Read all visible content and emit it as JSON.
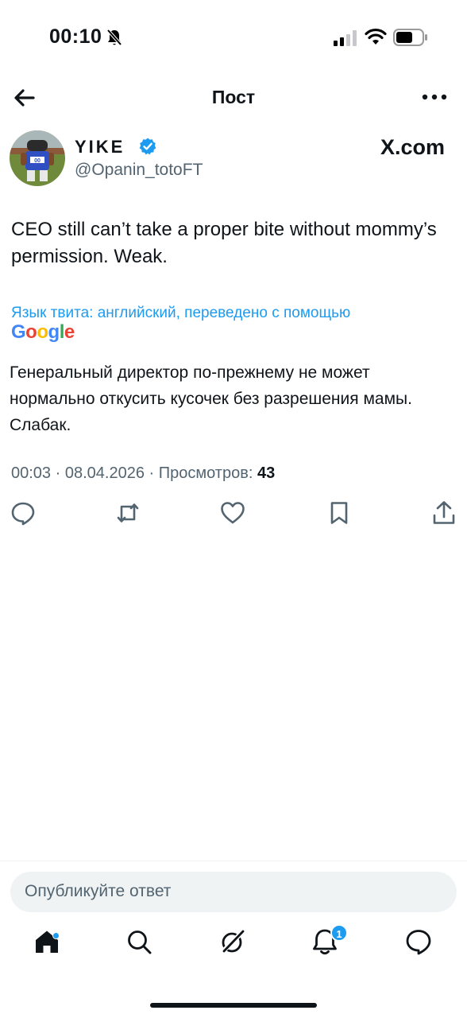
{
  "status_bar": {
    "time": "00:10",
    "icons": [
      "bell-off-icon",
      "signal-icon",
      "wifi-icon",
      "battery-icon"
    ]
  },
  "header": {
    "title": "Пост",
    "back_icon": "arrow-left-icon",
    "more_icon": "more-horizontal-icon"
  },
  "author": {
    "display_name": "YIKE",
    "handle": "@Opanin_totoFT",
    "verified": true,
    "source_logo": "X.com"
  },
  "tweet": {
    "text": "CEO still can’t take a proper bite without mommy’s permission. Weak.",
    "translation_note": "Язык твита: английский, переведено с помощью",
    "translation_provider": "Google",
    "translated_text": "Генеральный директор по-прежнему не может нормально откусить кусочек без разрешения мамы. Слабак.",
    "time": "00:03",
    "date": "08.04.2026",
    "views_label": "Просмотров:",
    "views_count": "43"
  },
  "actions": [
    "reply-icon",
    "retweet-icon",
    "like-icon",
    "bookmark-icon",
    "share-icon"
  ],
  "reply": {
    "placeholder": "Опубликуйте ответ"
  },
  "tabbar": {
    "items": [
      "home-icon",
      "search-icon",
      "grok-icon",
      "notifications-icon",
      "messages-icon"
    ],
    "notifications_badge": "1"
  },
  "colors": {
    "accent": "#1d9bf0",
    "text": "#0f1419",
    "secondary": "#536471",
    "reply_bg": "#eff3f4"
  }
}
